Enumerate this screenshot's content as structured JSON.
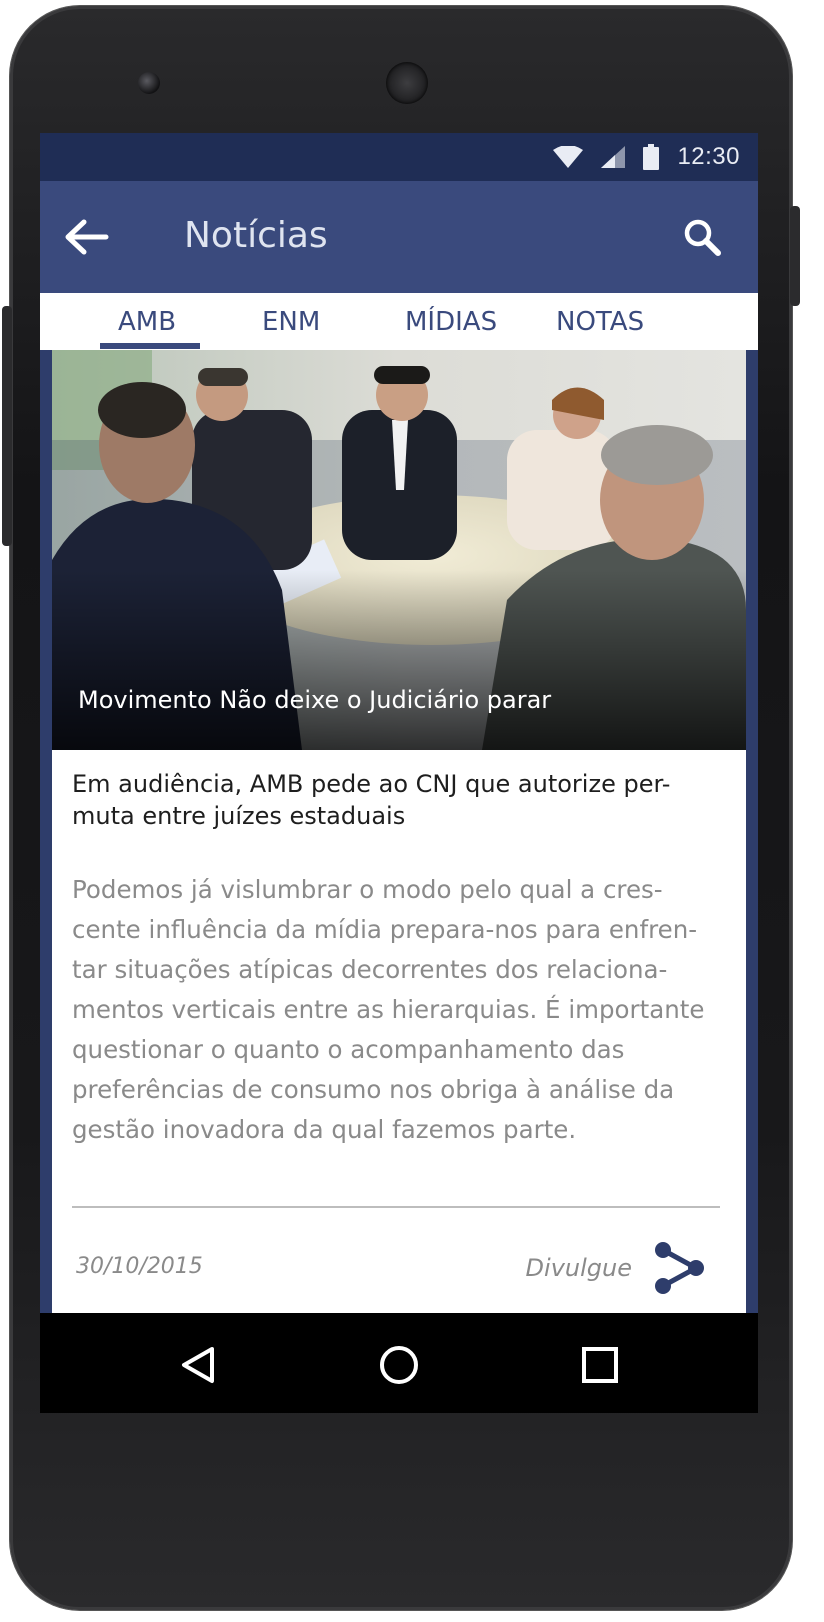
{
  "status": {
    "time": "12:30"
  },
  "appbar": {
    "title": "Notícias"
  },
  "tabs": [
    {
      "label": "AMB",
      "active": true
    },
    {
      "label": "ENM"
    },
    {
      "label": "MÍDIAS"
    },
    {
      "label": "NOTAS"
    }
  ],
  "article": {
    "caption": "Movimento Não deixe o Judiciário parar",
    "headline_lines": [
      "Em audiência, AMB pede ao CNJ que autorize per-",
      "muta entre juízes estaduais"
    ],
    "body_lines": [
      "Podemos já vislumbrar o modo pelo qual a cres-",
      "cente influência da mídia prepara-nos para enfren-",
      "tar situações atípicas decorrentes dos relaciona-",
      "mentos verticais entre as hierarquias. É importante",
      "questionar o quanto o acompanhamento das",
      "preferências de consumo nos obriga à análise da",
      "gestão inovadora da qual fazemos parte."
    ],
    "date": "30/10/2015",
    "share_label": "Divulgue"
  },
  "colors": {
    "primary": "#3a4a7d",
    "statusbar": "#1f2d55",
    "text_muted": "#8a8a8a"
  },
  "icons": [
    "back-arrow-icon",
    "search-icon",
    "wifi-icon",
    "signal-icon",
    "battery-icon",
    "share-icon",
    "nav-back-icon",
    "nav-home-icon",
    "nav-recents-icon"
  ]
}
